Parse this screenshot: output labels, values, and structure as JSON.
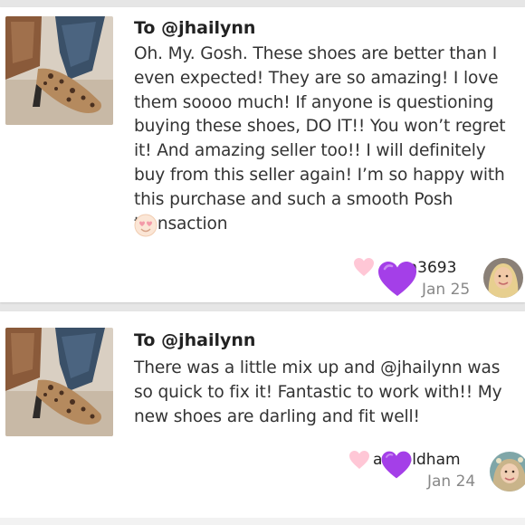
{
  "reviews": [
    {
      "to": "To @jhailynn",
      "message": "Oh. My. Gosh. These shoes are better than I even expected! They are so amazing! I love them soooo much! If anyone is questioning buying these shoes, DO IT!! You won’t regret it! And amazing seller too!! I will definitely buy from this seller again! I’m so happy with this purchase and such a smooth Posh transaction",
      "emoji": "heart-eyes-emoji",
      "username": "on3693",
      "date": "Jan 25",
      "like_color": "#ffc7d6",
      "overlay_color": "#a43fe8"
    },
    {
      "to": "To @jhailynn",
      "message": "There was a little mix up and @jhailynn was so quick to fix it! Fantastic to work with!! My new shoes are darling and fit well!",
      "username": "a    eroldham",
      "date": "Jan 24",
      "like_color": "#ffc7d6",
      "overlay_color": "#a43fe8"
    }
  ]
}
